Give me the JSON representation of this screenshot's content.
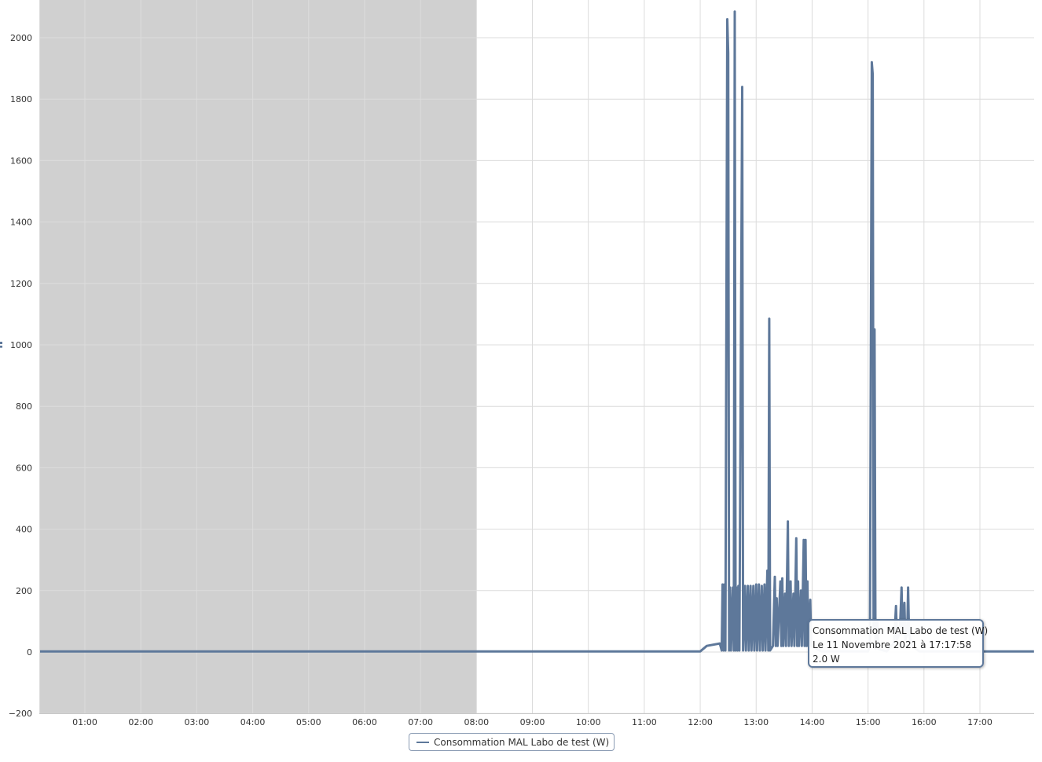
{
  "colors": {
    "series": "#5e789a",
    "grid": "#dcdcdc",
    "plot_band": "#d0d0d0",
    "background": "#ffffff"
  },
  "legend": {
    "label": "Consommation MAL Labo de test (W)",
    "placement": "bottom-center"
  },
  "tooltip": {
    "series_name": "Consommation MAL Labo de test (W)",
    "timestamp": "Le 11 Novembre 2021 à 17:17:58",
    "value": "2.0 W"
  },
  "chart_data": {
    "type": "line",
    "title": "",
    "xlabel": "",
    "ylabel": "",
    "grid": true,
    "x_unit": "hours of day (11 Novembre 2021)",
    "xlim": [
      "00:12",
      "17:58"
    ],
    "ylim": [
      -200,
      2100
    ],
    "x_ticks": [
      "01:00",
      "02:00",
      "03:00",
      "04:00",
      "05:00",
      "06:00",
      "07:00",
      "08:00",
      "09:00",
      "10:00",
      "11:00",
      "12:00",
      "13:00",
      "14:00",
      "15:00",
      "16:00",
      "17:00"
    ],
    "y_ticks": [
      2000,
      1800,
      1600,
      1400,
      1200,
      1000,
      800,
      600,
      400,
      200,
      0,
      -200
    ],
    "plot_band": {
      "from": "00:00",
      "to": "08:00"
    },
    "series": [
      {
        "name": "Consommation MAL Labo de test (W)",
        "points": [
          [
            "00:12",
            2
          ],
          [
            "08:00",
            2
          ],
          [
            "12:00",
            2
          ],
          [
            "12:07",
            20
          ],
          [
            "12:21",
            28
          ],
          [
            "12:23",
            5
          ],
          [
            "12:24",
            220
          ],
          [
            "12:25",
            5
          ],
          [
            "12:26",
            220
          ],
          [
            "12:27",
            5
          ],
          [
            "12:29",
            2060
          ],
          [
            "12:30",
            1950
          ],
          [
            "12:31",
            5
          ],
          [
            "12:32",
            210
          ],
          [
            "12:33",
            5
          ],
          [
            "12:35",
            210
          ],
          [
            "12:36",
            5
          ],
          [
            "12:37",
            2085
          ],
          [
            "12:38",
            5
          ],
          [
            "12:39",
            210
          ],
          [
            "12:40",
            5
          ],
          [
            "12:41",
            215
          ],
          [
            "12:42",
            5
          ],
          [
            "12:45",
            1840
          ],
          [
            "12:46",
            5
          ],
          [
            "12:48",
            215
          ],
          [
            "12:49",
            5
          ],
          [
            "12:51",
            215
          ],
          [
            "12:52",
            5
          ],
          [
            "12:54",
            215
          ],
          [
            "12:55",
            5
          ],
          [
            "12:57",
            215
          ],
          [
            "12:58",
            5
          ],
          [
            "13:00",
            220
          ],
          [
            "13:01",
            5
          ],
          [
            "13:03",
            220
          ],
          [
            "13:04",
            5
          ],
          [
            "13:06",
            215
          ],
          [
            "13:07",
            5
          ],
          [
            "13:09",
            220
          ],
          [
            "13:10",
            5
          ],
          [
            "13:12",
            265
          ],
          [
            "13:13",
            5
          ],
          [
            "13:14",
            1085
          ],
          [
            "13:15",
            5
          ],
          [
            "13:18",
            20
          ],
          [
            "13:20",
            245
          ],
          [
            "13:21",
            20
          ],
          [
            "13:22",
            175
          ],
          [
            "13:23",
            20
          ],
          [
            "13:26",
            230
          ],
          [
            "13:27",
            20
          ],
          [
            "13:28",
            240
          ],
          [
            "13:29",
            20
          ],
          [
            "13:31",
            190
          ],
          [
            "13:32",
            20
          ],
          [
            "13:34",
            425
          ],
          [
            "13:35",
            20
          ],
          [
            "13:37",
            230
          ],
          [
            "13:38",
            20
          ],
          [
            "13:40",
            190
          ],
          [
            "13:41",
            20
          ],
          [
            "13:43",
            370
          ],
          [
            "13:44",
            20
          ],
          [
            "13:45",
            230
          ],
          [
            "13:46",
            20
          ],
          [
            "13:48",
            200
          ],
          [
            "13:49",
            20
          ],
          [
            "13:51",
            365
          ],
          [
            "13:52",
            20
          ],
          [
            "13:53",
            365
          ],
          [
            "13:54",
            20
          ],
          [
            "13:55",
            230
          ],
          [
            "13:56",
            20
          ],
          [
            "13:58",
            170
          ],
          [
            "13:59",
            20
          ],
          [
            "14:10",
            2
          ],
          [
            "14:50",
            2
          ],
          [
            "15:00",
            2
          ],
          [
            "15:02",
            20
          ],
          [
            "15:04",
            1920
          ],
          [
            "15:05",
            1880
          ],
          [
            "15:06",
            60
          ],
          [
            "15:07",
            1050
          ],
          [
            "15:08",
            10
          ],
          [
            "15:10",
            100
          ],
          [
            "15:11",
            10
          ],
          [
            "15:20",
            2
          ],
          [
            "15:28",
            30
          ],
          [
            "15:30",
            150
          ],
          [
            "15:31",
            40
          ],
          [
            "15:34",
            60
          ],
          [
            "15:36",
            210
          ],
          [
            "15:37",
            60
          ],
          [
            "15:39",
            160
          ],
          [
            "15:40",
            40
          ],
          [
            "15:42",
            60
          ],
          [
            "15:43",
            210
          ],
          [
            "15:44",
            60
          ],
          [
            "15:47",
            20
          ],
          [
            "15:55",
            2
          ],
          [
            "17:17",
            2
          ],
          [
            "17:58",
            2
          ]
        ]
      }
    ]
  }
}
